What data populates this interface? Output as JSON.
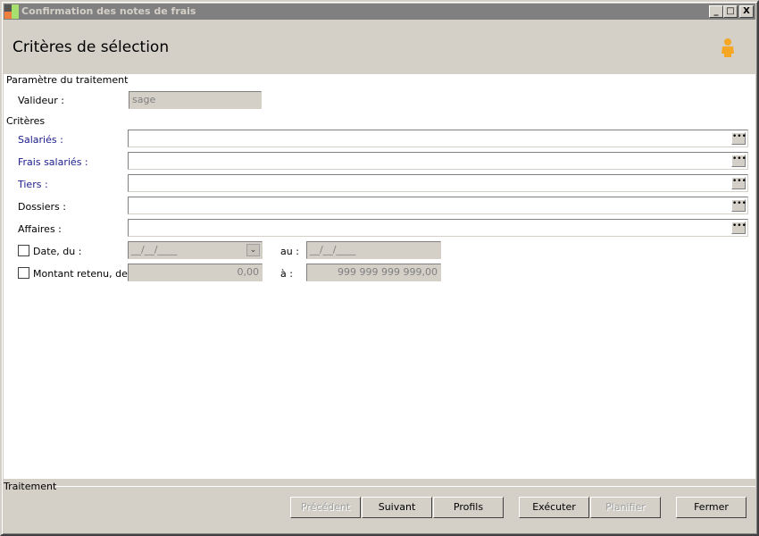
{
  "window": {
    "title": "Confirmation des notes de frais",
    "minimize": "_",
    "maximize": "□",
    "close": "X"
  },
  "header": {
    "title": "Critères de sélection",
    "user_icon": "user-icon"
  },
  "params": {
    "section": "Paramètre du traitement",
    "validator_label": "Valideur :",
    "validator_value": "sage"
  },
  "criteria": {
    "section": "Critères",
    "fields": [
      {
        "label": "Salariés :"
      },
      {
        "label": "Frais salariés :"
      },
      {
        "label": "Tiers :"
      },
      {
        "label": "Dossiers :"
      },
      {
        "label": "Affaires :"
      }
    ],
    "ellipsis": "•••",
    "date_label": "Date, du :",
    "date_from": "__/__/____",
    "date_to_label": "au :",
    "date_to": "__/__/____",
    "amount_label": "Montant retenu, de :",
    "amount_from": "0,00",
    "amount_to_label": "à :",
    "amount_to": "999 999 999 999,00"
  },
  "footer": {
    "section": "Traitement",
    "buttons": {
      "previous": "Précédent",
      "next": "Suivant",
      "profiles": "Profils",
      "execute": "Exécuter",
      "schedule": "Planifier",
      "close": "Fermer"
    }
  }
}
